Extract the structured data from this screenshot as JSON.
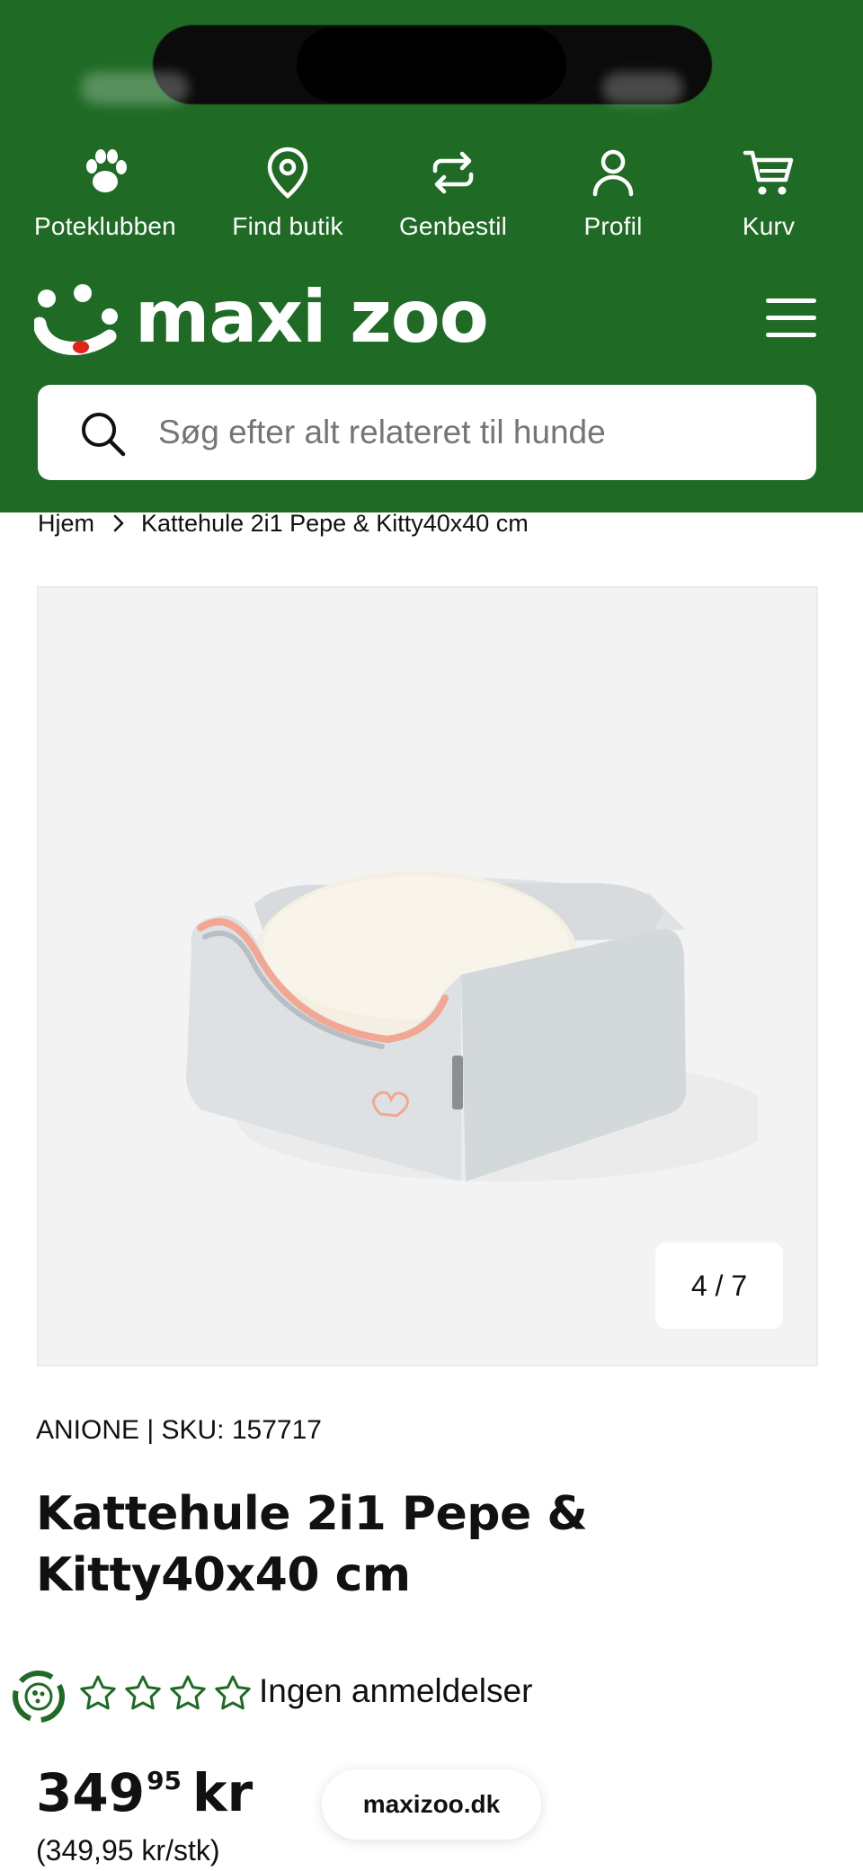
{
  "topnav": {
    "items": [
      {
        "label": "Poteklubben",
        "icon": "paw-icon"
      },
      {
        "label": "Find butik",
        "icon": "location-pin-icon"
      },
      {
        "label": "Genbestil",
        "icon": "repeat-icon"
      },
      {
        "label": "Profil",
        "icon": "user-icon"
      },
      {
        "label": "Kurv",
        "icon": "cart-icon"
      }
    ]
  },
  "brand": {
    "logo_text": "maxi zoo"
  },
  "search": {
    "placeholder": "Søg efter alt relateret til hunde"
  },
  "breadcrumb": {
    "home": "Hjem",
    "current": "Kattehule 2i1 Pepe & Kitty40x40 cm"
  },
  "gallery": {
    "counter": "4 / 7"
  },
  "product": {
    "brand_sku": "ANIONE | SKU: 157717",
    "title": "Kattehule 2i1 Pepe & Kitty40x40 cm",
    "reviews_text": "Ingen anmeldelser",
    "rating_stars": 0,
    "rating_max": 5,
    "price_integer": "349",
    "price_decimal": "95",
    "price_currency": "kr",
    "unit_price": "(349,95 kr/stk)"
  },
  "browser": {
    "domain": "maxizoo.dk"
  },
  "colors": {
    "header_green": "#1f6b26",
    "accent_red": "#e2231a",
    "text": "#111111"
  }
}
